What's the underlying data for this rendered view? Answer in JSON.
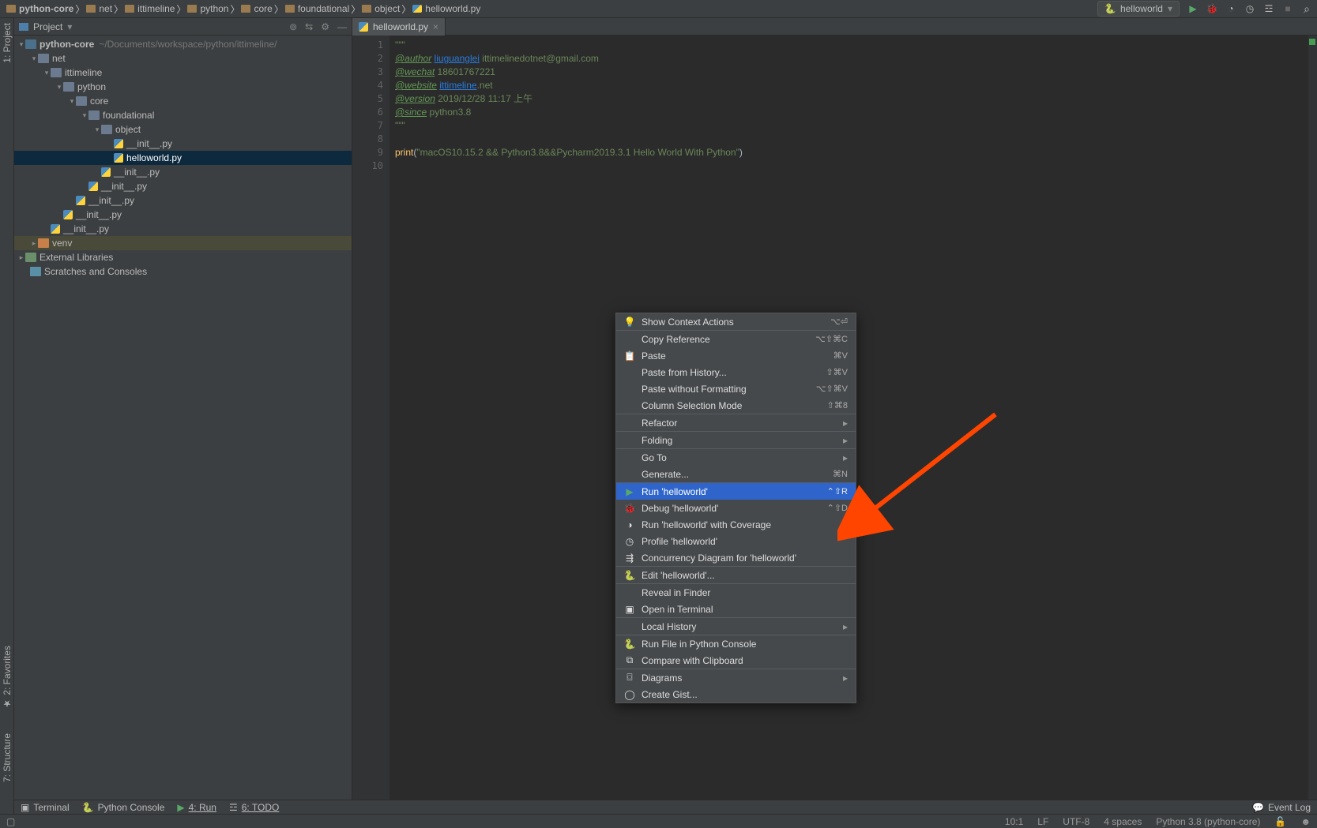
{
  "breadcrumbs": [
    "python-core",
    "net",
    "ittimeline",
    "python",
    "core",
    "foundational",
    "object",
    "helloworld.py"
  ],
  "run_config": {
    "name": "helloworld"
  },
  "project": {
    "toolwindow_title": "Project",
    "root_name": "python-core",
    "root_path": "~/Documents/workspace/python/ittimeline/",
    "nodes": {
      "net": "net",
      "ittimeline": "ittimeline",
      "python": "python",
      "core": "core",
      "foundational": "foundational",
      "object": "object",
      "init": "__init__.py",
      "hello": "helloworld.py",
      "venv": "venv",
      "extlib": "External Libraries",
      "scratch": "Scratches and Consoles"
    }
  },
  "editor": {
    "tab": "helloworld.py",
    "lines": [
      "1",
      "2",
      "3",
      "4",
      "5",
      "6",
      "7",
      "8",
      "9",
      "10"
    ],
    "code": {
      "l1": "\"\"\"",
      "l2a": "@author",
      "l2b": "liuguanglei",
      "l2c": "ittimelinedotnet@gmail.com",
      "l3a": "@wechat",
      "l3b": "18601767221",
      "l4a": "@website",
      "l4b": "ittimeline",
      "l4c": ".net",
      "l5a": "@version",
      "l5b": "2019/12/28 11:17 上午",
      "l6a": "@since",
      "l6b": "python3.8",
      "l7": "\"\"\"",
      "l8": "",
      "l9a": "print",
      "l9b": "(",
      "l9c": "\"macOS10.15.2 && Python3.8&&Pycharm2019.3.1 Hello World With Python\"",
      "l9d": ")"
    }
  },
  "context_menu": [
    {
      "label": "Show Context Actions",
      "shortcut": "⌥⏎",
      "icon": "bulb"
    },
    {
      "sep": true
    },
    {
      "label": "Copy Reference",
      "shortcut": "⌥⇧⌘C"
    },
    {
      "label": "Paste",
      "shortcut": "⌘V",
      "icon": "paste"
    },
    {
      "label": "Paste from History...",
      "shortcut": "⇧⌘V"
    },
    {
      "label": "Paste without Formatting",
      "shortcut": "⌥⇧⌘V"
    },
    {
      "label": "Column Selection Mode",
      "shortcut": "⇧⌘8"
    },
    {
      "sep": true
    },
    {
      "label": "Refactor",
      "submenu": true
    },
    {
      "sep": true
    },
    {
      "label": "Folding",
      "submenu": true
    },
    {
      "sep": true
    },
    {
      "label": "Go To",
      "submenu": true
    },
    {
      "label": "Generate...",
      "shortcut": "⌘N"
    },
    {
      "sep": true
    },
    {
      "label": "Run 'helloworld'",
      "shortcut": "⌃⇧R",
      "icon": "run",
      "selected": true
    },
    {
      "label": "Debug 'helloworld'",
      "shortcut": "⌃⇧D",
      "icon": "debug"
    },
    {
      "label": "Run 'helloworld' with Coverage",
      "icon": "coverage"
    },
    {
      "label": "Profile 'helloworld'",
      "icon": "profile"
    },
    {
      "label": "Concurrency Diagram for 'helloworld'",
      "icon": "concur"
    },
    {
      "sep": true
    },
    {
      "label": "Edit 'helloworld'...",
      "icon": "py"
    },
    {
      "sep": true
    },
    {
      "label": "Reveal in Finder"
    },
    {
      "label": "Open in Terminal",
      "icon": "term"
    },
    {
      "sep": true
    },
    {
      "label": "Local History",
      "submenu": true
    },
    {
      "sep": true
    },
    {
      "label": "Run File in Python Console",
      "icon": "pycon"
    },
    {
      "label": "Compare with Clipboard",
      "icon": "diff"
    },
    {
      "sep": true
    },
    {
      "label": "Diagrams",
      "submenu": true,
      "icon": "diag"
    },
    {
      "label": "Create Gist...",
      "icon": "gh"
    }
  ],
  "toolwindows": {
    "terminal": "Terminal",
    "pyconsole": "Python Console",
    "run": "4: Run",
    "todo": "6: TODO",
    "eventlog": "Event Log"
  },
  "leftrail": {
    "project": "1: Project",
    "favorites": "2: Favorites",
    "structure": "7: Structure"
  },
  "status": {
    "pos": "10:1",
    "eol": "LF",
    "enc": "UTF-8",
    "indent": "4 spaces",
    "interp": "Python 3.8 (python-core)"
  }
}
